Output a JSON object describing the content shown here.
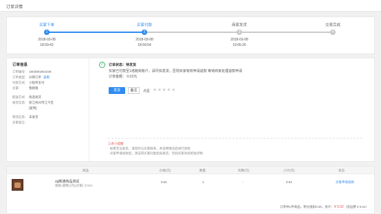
{
  "page": {
    "title": "订单详情"
  },
  "progress": {
    "steps": [
      {
        "label": "买家下单",
        "num": "1",
        "date": "2018-03-08",
        "time": "18:59:42",
        "active": true
      },
      {
        "label": "买家付款",
        "num": "2",
        "date": "2018-03-08",
        "time": "18:59:54",
        "active": true
      },
      {
        "label": "商家发货",
        "num": "3",
        "date": "2018-03-08",
        "time": "19:05:26",
        "active": false
      },
      {
        "label": "交易完成",
        "num": "4",
        "date": "",
        "time": "",
        "active": false
      }
    ]
  },
  "order_info": {
    "heading": "订单信息",
    "rows": [
      {
        "k": "订单编号:",
        "v": "1803081854238",
        "link": ""
      },
      {
        "k": "订单类型:",
        "v": "分销订单",
        "link": "查看"
      },
      {
        "k": "付款方式:",
        "v": "小程序支付",
        "link": ""
      },
      {
        "k": "买家:",
        "v": "我猜猜",
        "link": ""
      }
    ],
    "rows2": [
      {
        "k": "配送方式:",
        "v": "快递发货"
      },
      {
        "k": "收货信息:",
        "v": "浙江杭州市江干区"
      },
      {
        "k": "",
        "v": "[复制]"
      }
    ],
    "rows3": [
      {
        "k": "物流信息:",
        "v": "未发货"
      },
      {
        "k": "买家留言:",
        "v": ""
      }
    ]
  },
  "status": {
    "check_icon": "check-circle-icon",
    "title_prefix": "订单状态：",
    "title_value": "待发货",
    "desc": "买家已付款至1诺链商账户，请尽快发货，否则买家有权申请退款 等待商家处理退款申请",
    "amount": "订单金额： 0.02元",
    "primary_button": "发货",
    "secondary_button": "备注",
    "rate_label": "点星",
    "stars": "★★★★★",
    "tips_head": "三条小提醒",
    "tips": [
      "· 如果无法发货，请及时与买家联系，并说明情况后进行退款",
      "· 买家申请退款后，须征得买家同意后再发货，否则买家有权拒收货物"
    ]
  },
  "table": {
    "headers": [
      "商品",
      "价格(元)",
      "数量",
      "优惠(元)",
      "小计(元)",
      "状态"
    ],
    "row": {
      "name": "zg刷通商品测试",
      "spec": "规格:通用(1元)(买家) 小X2×",
      "price": "0.01",
      "qty": "1",
      "discount": "-",
      "subtotal": "0.01",
      "status": "买家申请退款"
    },
    "summary_prefix": "订单共1件商品，积分抵扣0.00，优计：",
    "summary_total": "¥ 0.02",
    "summary_suffix": "（含运费 ¥ 0.01）"
  }
}
